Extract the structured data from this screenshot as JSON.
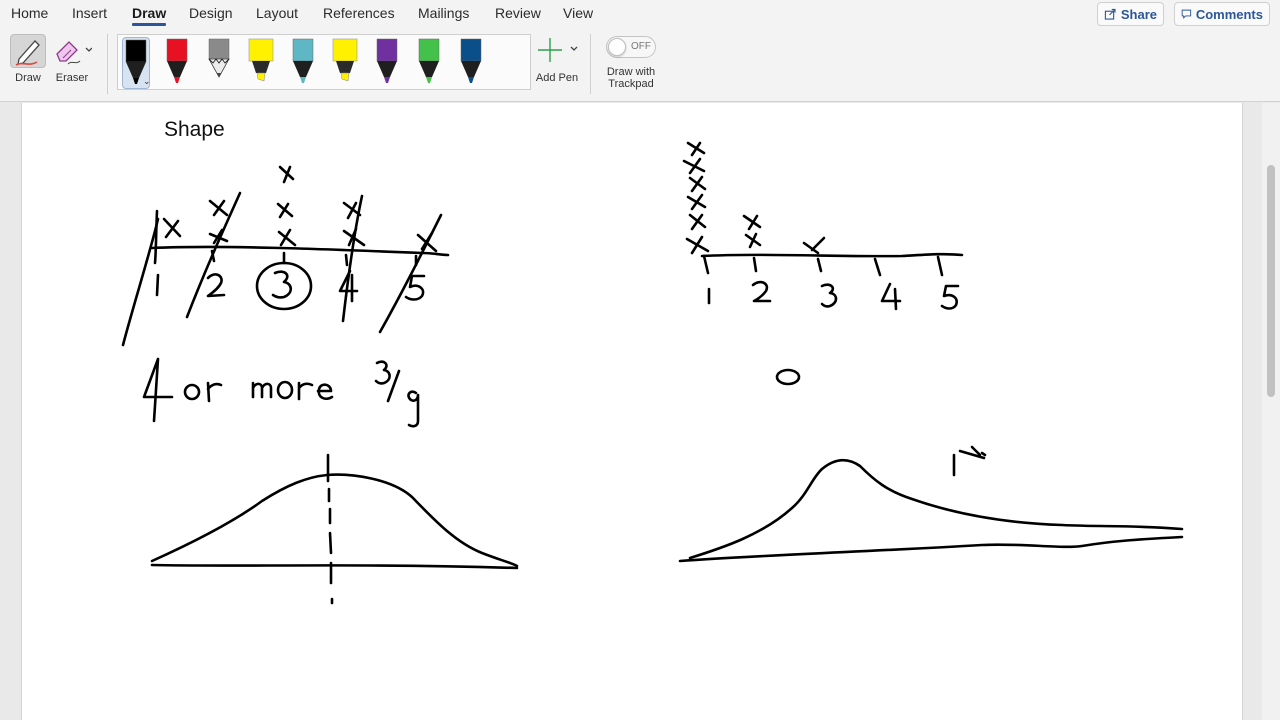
{
  "tabs": [
    {
      "label": "Home"
    },
    {
      "label": "Insert"
    },
    {
      "label": "Draw",
      "active": true
    },
    {
      "label": "Design"
    },
    {
      "label": "Layout"
    },
    {
      "label": "References"
    },
    {
      "label": "Mailings"
    },
    {
      "label": "Review"
    },
    {
      "label": "View"
    }
  ],
  "topright": {
    "share_label": "Share",
    "comments_label": "Comments"
  },
  "ribbon": {
    "draw_label": "Draw",
    "eraser_label": "Eraser",
    "add_pen_label": "Add Pen",
    "trackpad_label_line1": "Draw with",
    "trackpad_label_line2": "Trackpad",
    "trackpad_state": "OFF"
  },
  "pens": [
    {
      "name": "black-pen",
      "color": "#000000",
      "type": "pen",
      "selected": true
    },
    {
      "name": "red-pen",
      "color": "#e81123",
      "type": "pen"
    },
    {
      "name": "gray-pencil",
      "color": "#8a8a8a",
      "type": "pencil"
    },
    {
      "name": "yellow-highlighter",
      "color": "#fff100",
      "type": "highlighter"
    },
    {
      "name": "galaxy-pen",
      "color": "#5fb6c4",
      "type": "pen"
    },
    {
      "name": "yellow-highlighter-2",
      "color": "#fff100",
      "type": "highlighter"
    },
    {
      "name": "purple-pen",
      "color": "#7030a0",
      "type": "pen"
    },
    {
      "name": "green-pen",
      "color": "#44c14a",
      "type": "pen"
    },
    {
      "name": "blue-pen",
      "color": "#0b4f8a",
      "type": "pen"
    }
  ],
  "colors": {
    "accent": "#2b579a"
  },
  "document": {
    "heading": "Shape",
    "ink": {
      "numbers_left": [
        "1",
        "2",
        "3",
        "4",
        "5"
      ],
      "numbers_right": [
        "1",
        "2",
        "3",
        "4",
        "5"
      ],
      "note": "4 or more 3/9",
      "zero": "0",
      "label_1x": "1x"
    }
  }
}
